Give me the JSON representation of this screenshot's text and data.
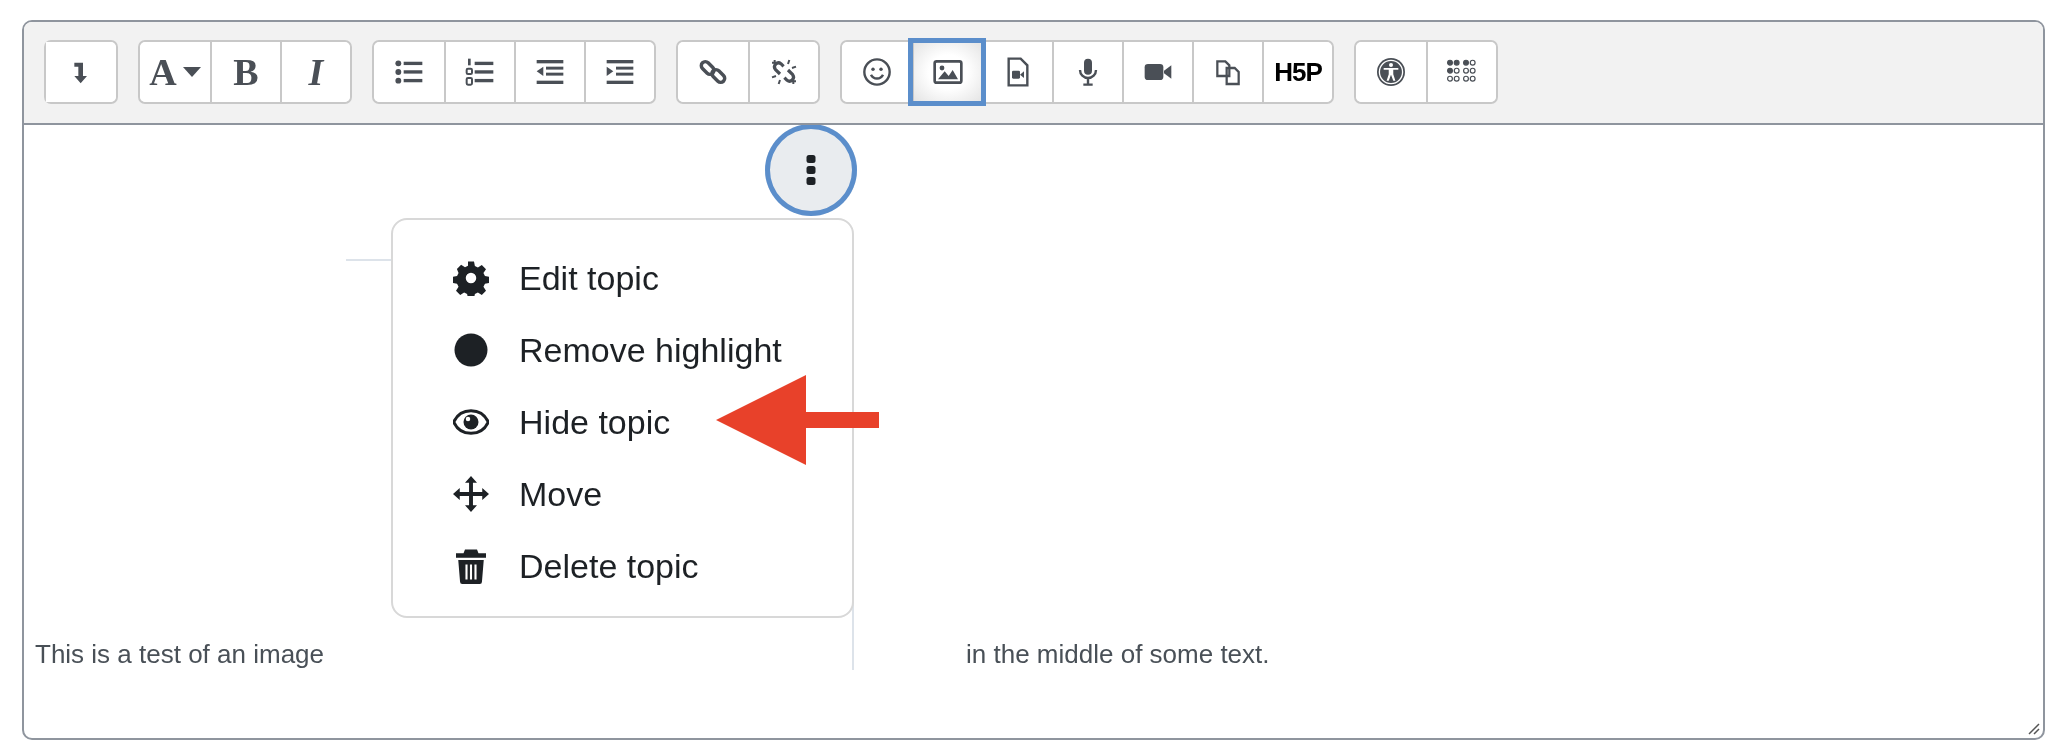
{
  "toolbar": {
    "groups": [
      {
        "buttons": [
          {
            "kind": "enter",
            "selected": false
          }
        ]
      },
      {
        "buttons": [
          {
            "kind": "font-color",
            "label": "A",
            "selected": false
          },
          {
            "kind": "bold",
            "label": "B",
            "selected": false
          },
          {
            "kind": "italic",
            "label": "I",
            "selected": false
          }
        ]
      },
      {
        "buttons": [
          {
            "kind": "bullet-list",
            "selected": false
          },
          {
            "kind": "numbered-list",
            "selected": false
          },
          {
            "kind": "outdent",
            "selected": false
          },
          {
            "kind": "indent",
            "selected": false
          }
        ]
      },
      {
        "buttons": [
          {
            "kind": "link",
            "selected": false
          },
          {
            "kind": "unlink",
            "selected": false
          }
        ]
      },
      {
        "buttons": [
          {
            "kind": "emoji",
            "selected": false
          },
          {
            "kind": "image",
            "selected": true
          },
          {
            "kind": "media-file",
            "selected": false
          },
          {
            "kind": "microphone",
            "selected": false
          },
          {
            "kind": "video",
            "selected": false
          },
          {
            "kind": "files",
            "selected": false
          },
          {
            "kind": "h5p",
            "label": "H5P",
            "selected": false
          }
        ]
      },
      {
        "buttons": [
          {
            "kind": "accessibility",
            "selected": false
          },
          {
            "kind": "braille",
            "selected": false
          }
        ]
      }
    ]
  },
  "content": {
    "text_before": "This is a test of an image",
    "text_after": "in the middle of some text.",
    "image": {
      "kebab_button": {
        "focused": true
      },
      "menu": [
        {
          "kind": "gear",
          "label": "Edit topic"
        },
        {
          "kind": "circle",
          "label": "Remove highlight"
        },
        {
          "kind": "eye",
          "label": "Hide topic"
        },
        {
          "kind": "move",
          "label": "Move"
        },
        {
          "kind": "trash",
          "label": "Delete topic"
        }
      ]
    }
  }
}
